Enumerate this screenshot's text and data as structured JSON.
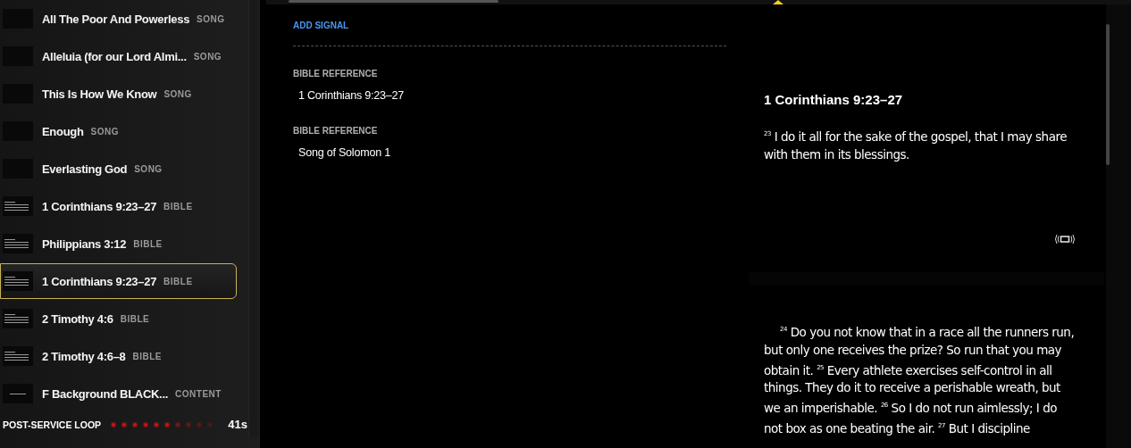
{
  "playlist": {
    "items": [
      {
        "title": "All The Poor And Powerless",
        "type": "SONG",
        "kind": "song",
        "selected": false
      },
      {
        "title": "Alleluia (for our Lord Almi...",
        "type": "SONG",
        "kind": "song",
        "selected": false
      },
      {
        "title": "This Is How We Know",
        "type": "SONG",
        "kind": "song",
        "selected": false
      },
      {
        "title": "Enough",
        "type": "SONG",
        "kind": "song",
        "selected": false
      },
      {
        "title": "Everlasting God",
        "type": "SONG",
        "kind": "song",
        "selected": false
      },
      {
        "title": "1 Corinthians 9:23–27",
        "type": "BIBLE",
        "kind": "bible",
        "selected": false
      },
      {
        "title": "Philippians 3:12",
        "type": "BIBLE",
        "kind": "bible",
        "selected": false
      },
      {
        "title": "1 Corinthians 9:23–27",
        "type": "BIBLE",
        "kind": "bible",
        "selected": true
      },
      {
        "title": "2 Timothy 4:6",
        "type": "BIBLE",
        "kind": "bible",
        "selected": false
      },
      {
        "title": "2 Timothy 4:6–8",
        "type": "BIBLE",
        "kind": "bible",
        "selected": false
      },
      {
        "title": "F Background BLACK...",
        "type": "CONTENT",
        "kind": "content",
        "selected": false
      }
    ],
    "loop": {
      "label": "POST-SERVICE LOOP",
      "level": 0.6,
      "time": "41s"
    }
  },
  "details": {
    "add_signal": "ADD SIGNAL",
    "fields": [
      {
        "label": "BIBLE REFERENCE",
        "value": "1 Corinthians 9:23–27"
      },
      {
        "label": "BIBLE REFERENCE",
        "value": "Song of Solomon 1"
      }
    ]
  },
  "slides": [
    {
      "heading": "1 Corinthians 9:23–27",
      "text": "$^{23}$ I do it all for the sake of the gospel, that I may share with them in its blessings.",
      "broadcast": true
    },
    {
      "text": "$^{24}$ Do you not know that in a race all the runners run, but only one receives the prize? So run that you may obtain it. $^{25}$ Every athlete exercises self-control in all things. They do it to receive a perishable wreath, but we an imperishable. $^{26}$ So I do not run aimlessly; I do not box as one beating the air. $^{27}$ But I discipline"
    }
  ]
}
